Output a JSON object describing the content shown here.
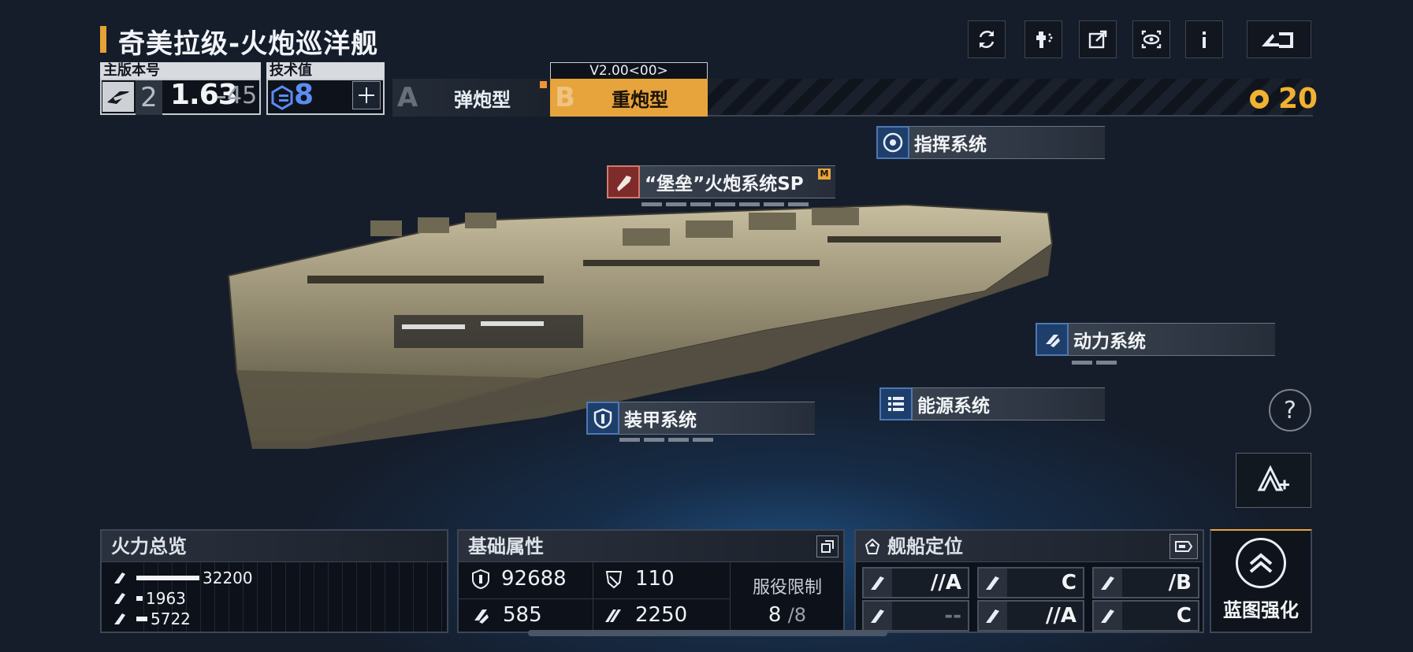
{
  "header": {
    "title": "奇美拉级-火炮巡洋舰"
  },
  "version": {
    "label": "主版本号",
    "major": "2",
    "num": "1.63",
    "sub": "45"
  },
  "tech": {
    "label": "技术值",
    "value": "8"
  },
  "modes": {
    "tag": "V2.00<00>",
    "a_letter": "A",
    "a_name": "弹炮型",
    "b_letter": "B",
    "b_name": "重炮型"
  },
  "points": "20",
  "systems": {
    "command": "指挥系统",
    "artillery": "“堡垒”火炮系统SP",
    "artillery_badge": "M",
    "power": "动力系统",
    "energy": "能源系统",
    "armor": "装甲系统"
  },
  "fire": {
    "title": "火力总览",
    "rows": [
      {
        "value": "32200",
        "fill": 1.0
      },
      {
        "value": "1963",
        "fill": 0.06
      },
      {
        "value": "5722",
        "fill": 0.18
      }
    ]
  },
  "base": {
    "title": "基础属性",
    "hp": "92688",
    "armor_val": "110",
    "shield": "585",
    "speed": "2250",
    "service_label": "服役限制",
    "service_cur": "8",
    "service_max": "/8"
  },
  "role": {
    "title": "舰船定位",
    "cells": [
      {
        "v": "//A"
      },
      {
        "v": "C"
      },
      {
        "v": "/B"
      },
      {
        "v": "--"
      },
      {
        "v": "//A"
      },
      {
        "v": "C"
      }
    ]
  },
  "blueprint": {
    "label": "蓝图强化"
  },
  "colors": {
    "accent": "#e7a43c",
    "tech": "#5b8cf2",
    "bg": "#151d2b"
  }
}
